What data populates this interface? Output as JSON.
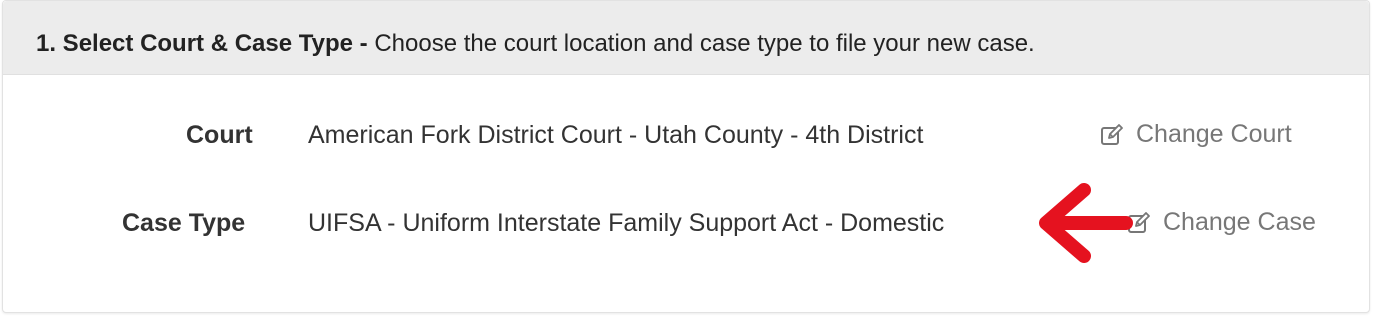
{
  "heading": {
    "step_title": "1. Select Court & Case Type -",
    "description": "Choose the court location and case type to file your new case."
  },
  "court_row": {
    "label": "Court",
    "value": "American Fork District Court - Utah County - 4th District",
    "change_label": "Change Court",
    "change_icon": "edit-icon"
  },
  "case_type_row": {
    "label": "Case Type",
    "value": "UIFSA - Uniform Interstate Family Support Act - Domestic",
    "change_label": "Change Case",
    "change_icon": "edit-icon"
  },
  "annotation": {
    "arrow_color": "#e5121f",
    "arrow_icon": "red-arrow-left-icon"
  },
  "colors": {
    "heading_bg": "#ececec",
    "link": "#777777",
    "text": "#333333"
  }
}
